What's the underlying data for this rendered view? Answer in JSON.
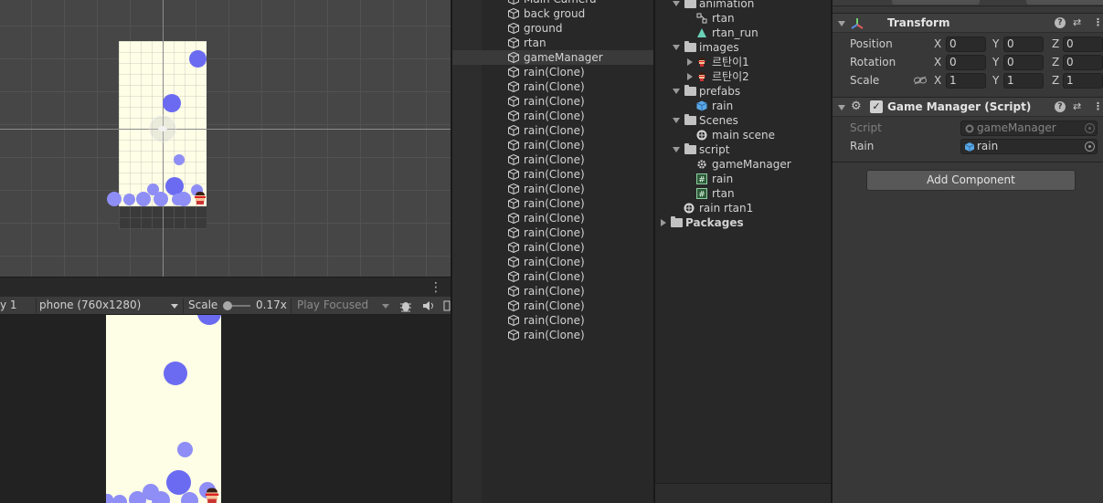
{
  "game_toolbar": {
    "display": "y 1",
    "resolution": "phone (760x1280)",
    "scale_label": "Scale",
    "scale_value": "0.17x",
    "play_mode": "Play Focused"
  },
  "hierarchy": {
    "items": [
      {
        "label": "Main Camera",
        "icon": "gameobject-cube-icon"
      },
      {
        "label": "back groud",
        "icon": "gameobject-cube-icon"
      },
      {
        "label": "ground",
        "icon": "gameobject-cube-icon"
      },
      {
        "label": "rtan",
        "icon": "gameobject-cube-icon"
      },
      {
        "label": "gameManager",
        "icon": "gameobject-cube-icon",
        "selected": true
      },
      {
        "label": "rain(Clone)",
        "icon": "gameobject-cube-icon"
      },
      {
        "label": "rain(Clone)",
        "icon": "gameobject-cube-icon"
      },
      {
        "label": "rain(Clone)",
        "icon": "gameobject-cube-icon"
      },
      {
        "label": "rain(Clone)",
        "icon": "gameobject-cube-icon"
      },
      {
        "label": "rain(Clone)",
        "icon": "gameobject-cube-icon"
      },
      {
        "label": "rain(Clone)",
        "icon": "gameobject-cube-icon"
      },
      {
        "label": "rain(Clone)",
        "icon": "gameobject-cube-icon"
      },
      {
        "label": "rain(Clone)",
        "icon": "gameobject-cube-icon"
      },
      {
        "label": "rain(Clone)",
        "icon": "gameobject-cube-icon"
      },
      {
        "label": "rain(Clone)",
        "icon": "gameobject-cube-icon"
      },
      {
        "label": "rain(Clone)",
        "icon": "gameobject-cube-icon"
      },
      {
        "label": "rain(Clone)",
        "icon": "gameobject-cube-icon"
      },
      {
        "label": "rain(Clone)",
        "icon": "gameobject-cube-icon"
      },
      {
        "label": "rain(Clone)",
        "icon": "gameobject-cube-icon"
      },
      {
        "label": "rain(Clone)",
        "icon": "gameobject-cube-icon"
      },
      {
        "label": "rain(Clone)",
        "icon": "gameobject-cube-icon"
      },
      {
        "label": "rain(Clone)",
        "icon": "gameobject-cube-icon"
      },
      {
        "label": "rain(Clone)",
        "icon": "gameobject-cube-icon"
      },
      {
        "label": "rain(Clone)",
        "icon": "gameobject-cube-icon"
      }
    ]
  },
  "project": {
    "items": [
      {
        "label": "animation",
        "type": "folder",
        "depth": 1,
        "expanded": true
      },
      {
        "label": "rtan",
        "type": "animator",
        "depth": 2
      },
      {
        "label": "rtan_run",
        "type": "animation-clip",
        "depth": 2
      },
      {
        "label": "images",
        "type": "folder",
        "depth": 1,
        "expanded": true
      },
      {
        "label": "르탄이1",
        "type": "sprite",
        "depth": 2,
        "collapsed": true
      },
      {
        "label": "르탄이2",
        "type": "sprite",
        "depth": 2,
        "collapsed": true
      },
      {
        "label": "prefabs",
        "type": "folder",
        "depth": 1,
        "expanded": true
      },
      {
        "label": "rain",
        "type": "prefab",
        "depth": 2
      },
      {
        "label": "Scenes",
        "type": "folder",
        "depth": 1,
        "expanded": true
      },
      {
        "label": "main scene",
        "type": "scene",
        "depth": 2
      },
      {
        "label": "script",
        "type": "folder",
        "depth": 1,
        "expanded": true
      },
      {
        "label": "gameManager",
        "type": "gear-script",
        "depth": 2
      },
      {
        "label": "rain",
        "type": "csharp-script",
        "depth": 2
      },
      {
        "label": "rtan",
        "type": "csharp-script",
        "depth": 2
      },
      {
        "label": "rain rtan1",
        "type": "scene",
        "depth": 1
      },
      {
        "label": "Packages",
        "type": "folder",
        "depth": 0,
        "collapsed": true,
        "bold": true
      }
    ]
  },
  "inspector": {
    "transform": {
      "title": "Transform",
      "position": {
        "label": "Position",
        "x": "0",
        "y": "0",
        "z": "0"
      },
      "rotation": {
        "label": "Rotation",
        "x": "0",
        "y": "0",
        "z": "0"
      },
      "scale": {
        "label": "Scale",
        "x": "1",
        "y": "1",
        "z": "1"
      }
    },
    "game_manager": {
      "title": "Game Manager (Script)",
      "enabled": "✓",
      "script_label": "Script",
      "script_value": "gameManager",
      "rain_label": "Rain",
      "rain_value": "rain"
    },
    "axis": {
      "x": "X",
      "y": "Y",
      "z": "Z"
    },
    "help_glyph": "?",
    "add_component": "Add Component"
  },
  "colors": {
    "ball": "#6b6bf2",
    "ball_light": "#8e8ef6",
    "scene_background": "#fefee6"
  }
}
